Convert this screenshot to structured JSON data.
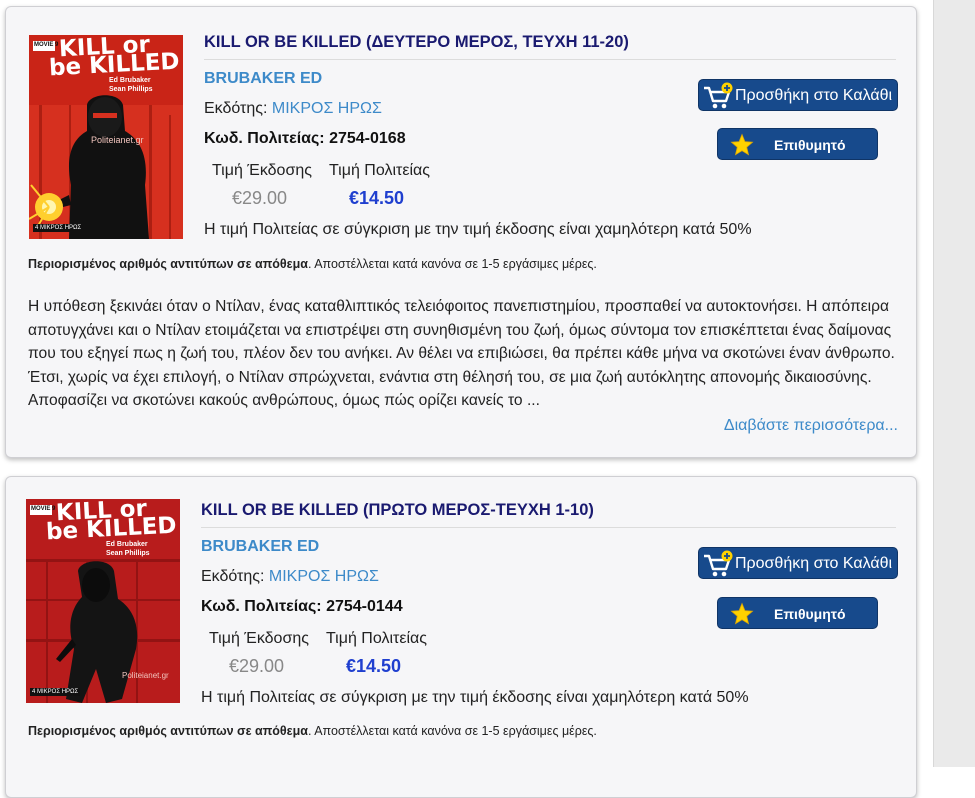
{
  "colors": {
    "accent_link": "#3d8ac9",
    "title": "#1a1a70",
    "price_new": "#1f3fcf",
    "button_bg": "#174a8c",
    "star": "#ffd200"
  },
  "products": [
    {
      "title": "KILL OR BE KILLED (ΔΕΥΤΕΡΟ ΜΕΡΟΣ, ΤΕΥΧΗ 11-20)",
      "author": "BRUBAKER ED",
      "publisher_label": "Εκδότης:",
      "publisher": "ΜΙΚΡΟΣ ΗΡΩΣ",
      "code": "Κωδ. Πολιτείας: 2754-0168",
      "price_label_old": "Τιμή Έκδοσης",
      "price_label_new": "Τιμή Πολιτείας",
      "price_old": "€29.00",
      "price_new": "€14.50",
      "compare": "Η τιμή Πολιτείας σε σύγκριση με την τιμή έκδοσης είναι χαμηλότερη κατά 50%",
      "availability_bold": "Περιορισμένος αριθμός αντιτύπων σε απόθεμα",
      "availability_rest": ". Αποστέλλεται κατά κανόνα σε 1-5 εργάσιμες μέρες.",
      "description": "Η υπόθεση ξεκινάει όταν ο Ντίλαν, ένας καταθλιπτικός τελειόφοιτος πανεπιστημίου, προσπαθεί να αυτοκτονήσει. Η απόπειρα αποτυγχάνει και ο Ντίλαν ετοιμάζεται να επιστρέψει στη συνηθισμένη του ζωή, όμως σύντομα τον επισκέπτεται ένας δαίμονας που του εξηγεί πως η ζωή του, πλέον δεν του ανήκει. Αν θέλει να επιβιώσει, θα πρέπει κάθε μήνα να σκοτώνει έναν άνθρωπο. Έτσι, χωρίς να έχει επιλογή, ο Ντίλαν σπρώχνεται, ενάντια στη θέλησή του, σε μια ζωή αυτόκλητης απονομής δικαιοσύνης. Αποφασίζει να σκοτώνει κακούς ανθρώπους, όμως πώς ορίζει κανείς το ...",
      "read_more": "Διαβάστε περισσότερα...",
      "add_to_cart": "Προσθήκη στο Καλάθι",
      "wishlist": "Επιθυμητό",
      "cover": {
        "title_line1": "KILL or",
        "title_line2": "be KILLED",
        "credits1": "Ed Brubaker",
        "credits2": "Sean Phillips",
        "badge": "MOVIE 9",
        "watermark": "Politeianet.gr",
        "logo": "4 ΜΙΚΡΟΣ ΗΡΩΣ"
      }
    },
    {
      "title": "KILL OR BE KILLED (ΠΡΩΤΟ ΜΕΡΟΣ-ΤΕΥΧΗ 1-10)",
      "author": "BRUBAKER ED",
      "publisher_label": "Εκδότης:",
      "publisher": "ΜΙΚΡΟΣ ΗΡΩΣ",
      "code": "Κωδ. Πολιτείας: 2754-0144",
      "price_label_old": "Τιμή Έκδοσης",
      "price_label_new": "Τιμή Πολιτείας",
      "price_old": "€29.00",
      "price_new": "€14.50",
      "compare": "Η τιμή Πολιτείας σε σύγκριση με την τιμή έκδοσης είναι χαμηλότερη κατά 50%",
      "availability_bold": "Περιορισμένος αριθμός αντιτύπων σε απόθεμα",
      "availability_rest": ". Αποστέλλεται κατά κανόνα σε 1-5 εργάσιμες μέρες.",
      "add_to_cart": "Προσθήκη στο Καλάθι",
      "wishlist": "Επιθυμητό",
      "cover": {
        "title_line1": "KILL or",
        "title_line2": "be KILLED",
        "credits1": "Ed Brubaker",
        "credits2": "Sean Phillips",
        "badge": "MOVIE 9",
        "watermark": "Politeianet.gr",
        "logo": "4 ΜΙΚΡΟΣ ΗΡΩΣ"
      }
    }
  ]
}
